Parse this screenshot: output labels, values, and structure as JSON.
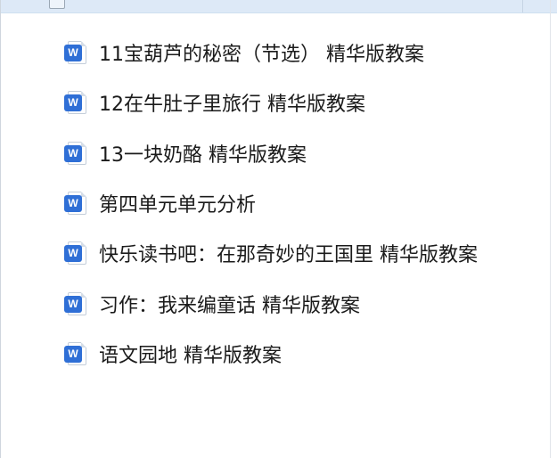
{
  "files": [
    {
      "name": "11宝葫芦的秘密（节选） 精华版教案",
      "icon": "word-doc-icon",
      "icon_letter": "W"
    },
    {
      "name": "12在牛肚子里旅行 精华版教案",
      "icon": "word-doc-icon",
      "icon_letter": "W"
    },
    {
      "name": "13一块奶酪 精华版教案",
      "icon": "word-doc-icon",
      "icon_letter": "W"
    },
    {
      "name": "第四单元单元分析",
      "icon": "word-doc-icon",
      "icon_letter": "W"
    },
    {
      "name": "快乐读书吧：在那奇妙的王国里 精华版教案",
      "icon": "word-doc-icon",
      "icon_letter": "W"
    },
    {
      "name": "习作：我来编童话 精华版教案",
      "icon": "word-doc-icon",
      "icon_letter": "W"
    },
    {
      "name": "语文园地 精华版教案",
      "icon": "word-doc-icon",
      "icon_letter": "W"
    }
  ],
  "colors": {
    "word_icon": "#2f6fd6",
    "top_bar": "#dde9f7",
    "text": "#1b1b1b"
  }
}
